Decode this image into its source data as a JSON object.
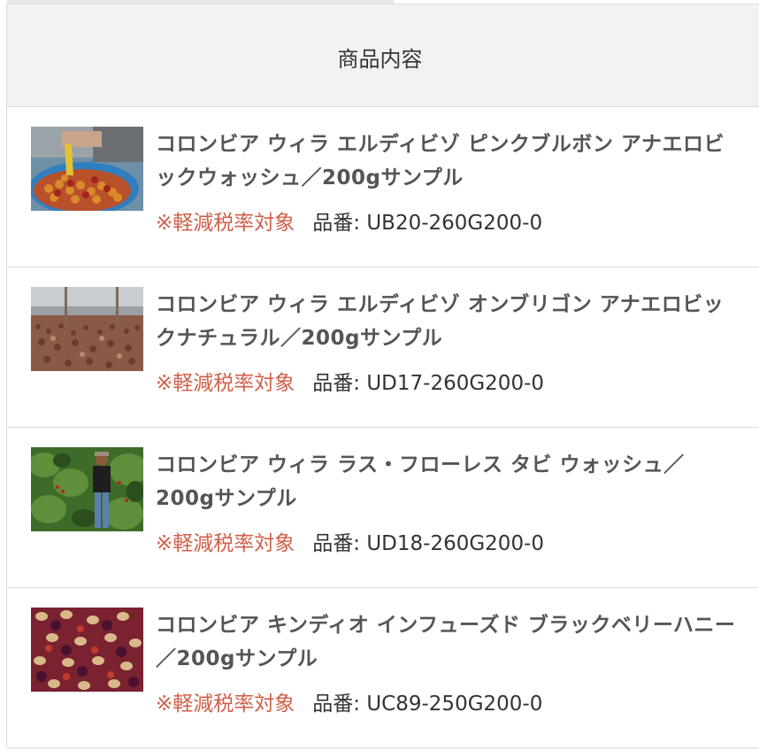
{
  "header": {
    "label": "商品内容"
  },
  "items": [
    {
      "title": "コロンビア ウィラ エルディビゾ ピンクブルボン アナエロビックウォッシュ／200gサンプル",
      "tax_note": "※軽減税率対象",
      "sku_label": "品番: UB20-260G200-0",
      "thumbnail": "coffee-cherries-in-basket"
    },
    {
      "title": "コロンビア ウィラ エルディビゾ オンブリゴン アナエロビックナチュラル／200gサンプル",
      "tax_note": "※軽減税率対象",
      "sku_label": "品番: UD17-260G200-0",
      "thumbnail": "drying-beds"
    },
    {
      "title": "コロンビア ウィラ ラス・フローレス タビ ウォッシュ／200gサンプル",
      "tax_note": "※軽減税率対象",
      "sku_label": "品番: UD18-260G200-0",
      "thumbnail": "farmer-in-coffee-plants"
    },
    {
      "title": "コロンビア キンディオ インフューズド ブラックベリーハニー／200gサンプル",
      "tax_note": "※軽減税率対象",
      "sku_label": "品番: UC89-250G200-0",
      "thumbnail": "beans-with-blackberries"
    }
  ],
  "colors": {
    "tax_note": "#d0604a",
    "header_bg": "#f2f2f2",
    "border": "#dcdcdc"
  }
}
